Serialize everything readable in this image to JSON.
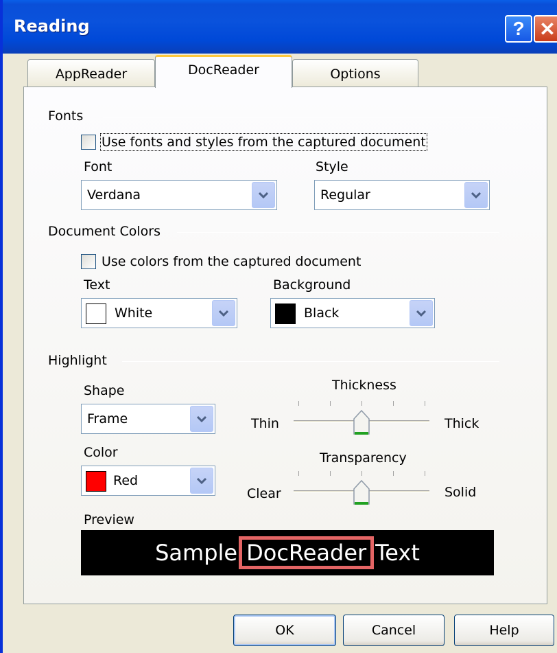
{
  "window": {
    "title": "Reading"
  },
  "titlebar": {
    "help_glyph": "?",
    "close_glyph": "✕"
  },
  "tabs": [
    {
      "label": "AppReader",
      "active": false
    },
    {
      "label": "DocReader",
      "active": true
    },
    {
      "label": "Options",
      "active": false
    }
  ],
  "fonts": {
    "group_label": "Fonts",
    "use_captured_label": "Use fonts and styles from the captured document",
    "use_captured_checked": false,
    "font_label": "Font",
    "font_value": "Verdana",
    "style_label": "Style",
    "style_value": "Regular"
  },
  "doc_colors": {
    "group_label": "Document Colors",
    "use_captured_label": "Use colors from the captured document",
    "use_captured_checked": false,
    "text_label": "Text",
    "text_value": "White",
    "text_swatch": "#ffffff",
    "background_label": "Background",
    "background_value": "Black",
    "background_swatch": "#000000"
  },
  "highlight": {
    "group_label": "Highlight",
    "shape_label": "Shape",
    "shape_value": "Frame",
    "color_label": "Color",
    "color_value": "Red",
    "color_swatch": "#ff0000",
    "thickness_label": "Thickness",
    "thickness_min_label": "Thin",
    "thickness_max_label": "Thick",
    "thickness_level": 0.5,
    "transparency_label": "Transparency",
    "transparency_min_label": "Clear",
    "transparency_max_label": "Solid",
    "transparency_level": 0.5,
    "preview_label": "Preview",
    "preview_before": "Sample",
    "preview_highlighted": "DocReader",
    "preview_after": "Text"
  },
  "buttons": {
    "ok": "OK",
    "cancel": "Cancel",
    "help": "Help"
  },
  "colors": {
    "titlebar": "#0a52dc",
    "dialog_bg": "#ece9d8",
    "active_tab_accent": "#ffc83c",
    "preview_frame": "#e46565"
  }
}
